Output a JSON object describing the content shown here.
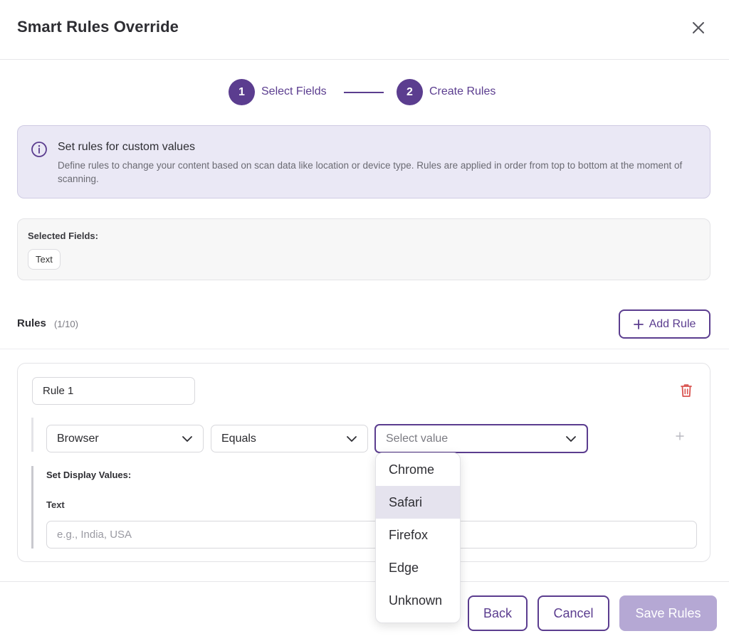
{
  "modal": {
    "title": "Smart Rules Override"
  },
  "stepper": {
    "steps": [
      {
        "number": "1",
        "label": "Select Fields"
      },
      {
        "number": "2",
        "label": "Create Rules"
      }
    ]
  },
  "info": {
    "title": "Set rules for custom values",
    "description": "Define rules to change your content based on scan data like location or device type. Rules are applied in order from top to bottom at the moment of scanning."
  },
  "selected_fields": {
    "label": "Selected Fields:",
    "chips": [
      "Text"
    ]
  },
  "rules": {
    "title": "Rules",
    "count": "(1/10)",
    "add_label": "Add Rule",
    "items": [
      {
        "name": "Rule 1",
        "condition": {
          "attribute": "Browser",
          "operator": "Equals",
          "value_placeholder": "Select value"
        },
        "display_label": "Set Display Values:",
        "field_label": "Text",
        "field_placeholder": "e.g., India, USA"
      }
    ]
  },
  "dropdown": {
    "options": [
      "Chrome",
      "Safari",
      "Firefox",
      "Edge",
      "Unknown"
    ],
    "highlighted": "Safari"
  },
  "footer": {
    "back": "Back",
    "cancel": "Cancel",
    "save": "Save Rules"
  },
  "colors": {
    "accent": "#5b3d8f",
    "disabled_primary": "#b5a8d4",
    "info_bg": "#eae8f5",
    "danger": "#d9534f"
  }
}
